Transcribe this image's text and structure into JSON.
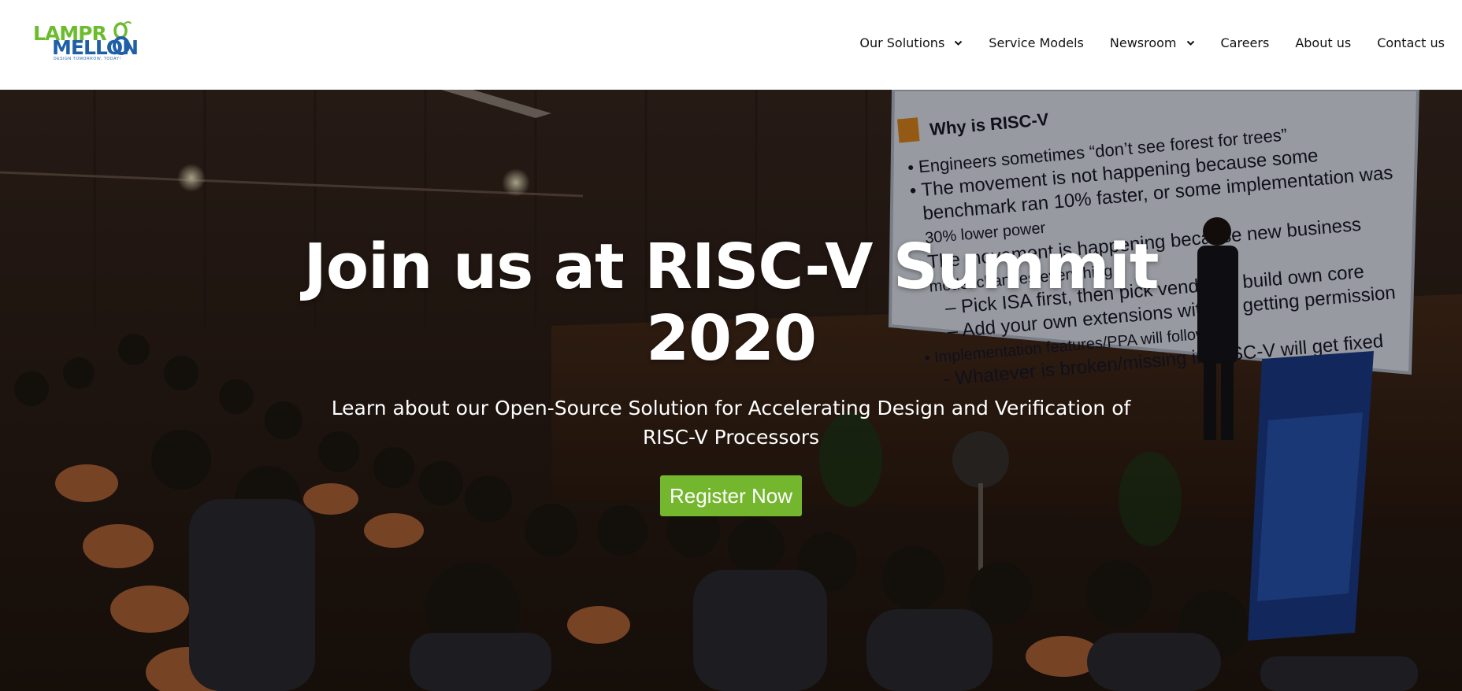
{
  "brand": {
    "logo_line1": "LAMPR",
    "logo_line2": "MELLON",
    "tagline": "DESIGN TOMORROW, TODAY!",
    "colors": {
      "green": "#6cbc2e",
      "blue": "#1f5fa8"
    }
  },
  "nav": {
    "items": [
      {
        "label": "Our Solutions",
        "has_dropdown": true
      },
      {
        "label": "Service Models",
        "has_dropdown": false
      },
      {
        "label": "Newsroom",
        "has_dropdown": true
      },
      {
        "label": "Careers",
        "has_dropdown": false
      },
      {
        "label": "About us",
        "has_dropdown": false
      },
      {
        "label": "Contact us",
        "has_dropdown": false
      }
    ]
  },
  "hero": {
    "title": "Join us at RISC-V Summit 2020",
    "subtitle": "Learn about our Open-Source Solution for Accelerating Design and Verification of RISC-V Processors",
    "cta_label": "Register Now",
    "cta_color": "#74b72e",
    "slide": {
      "heading": "Why is RISC-V",
      "lines": [
        "• Engineers sometimes “don’t see forest for trees”",
        "• The movement is not happening because some",
        "benchmark ran 10% faster, or some implementation was",
        "30% lower power",
        "• The movement is happening because new business",
        "model changes everything",
        "– Pick ISA first, then pick vendor or build own core",
        "– Add your own extensions without getting permission",
        "• Implementation features/PPA will follow",
        "- Whatever is broken/missing in RISC-V will get fixed"
      ]
    }
  }
}
